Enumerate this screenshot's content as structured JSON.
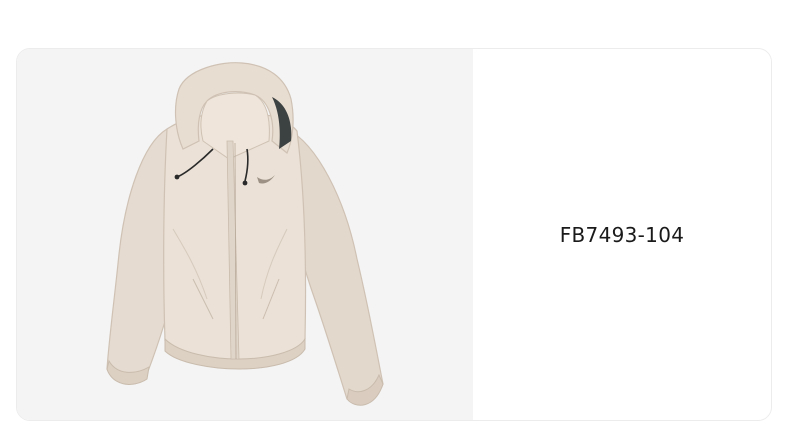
{
  "product": {
    "image_icon": "jacket-image",
    "code": "FB7493-104"
  }
}
